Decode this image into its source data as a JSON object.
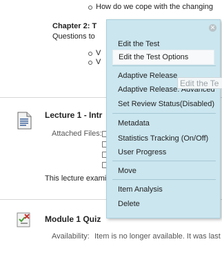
{
  "content": {
    "top_bullet": "How do we cope with the changing",
    "chapter_title": "Chapter 2: T",
    "chapter_sub": "Questions to",
    "chapter_bullet_1": "V",
    "chapter_bullet_2": "V",
    "lecture": {
      "title": "Lecture 1 - Intr",
      "attached_label": "Attached Files:",
      "description": "This lecture exami"
    },
    "quiz": {
      "title": "Module 1 Quiz",
      "availability_label": "Availability:",
      "availability_text": "Item is no longer available. It was last av"
    }
  },
  "context_menu": {
    "items": [
      {
        "label": "Edit the Test"
      },
      {
        "label": "Edit the Test Options"
      },
      {
        "label": "Adaptive Release"
      },
      {
        "label": "Adaptive Release: Advanced"
      },
      {
        "label": "Set Review Status(Disabled)"
      },
      {
        "label": "Metadata"
      },
      {
        "label": "Statistics Tracking (On/Off)"
      },
      {
        "label": "User Progress"
      },
      {
        "label": "Move"
      },
      {
        "label": "Item Analysis"
      },
      {
        "label": "Delete"
      }
    ],
    "tooltip": "Edit the Te"
  },
  "colors": {
    "menu_bg": "#cbe6ef",
    "menu_active": "#f7f9fa"
  }
}
